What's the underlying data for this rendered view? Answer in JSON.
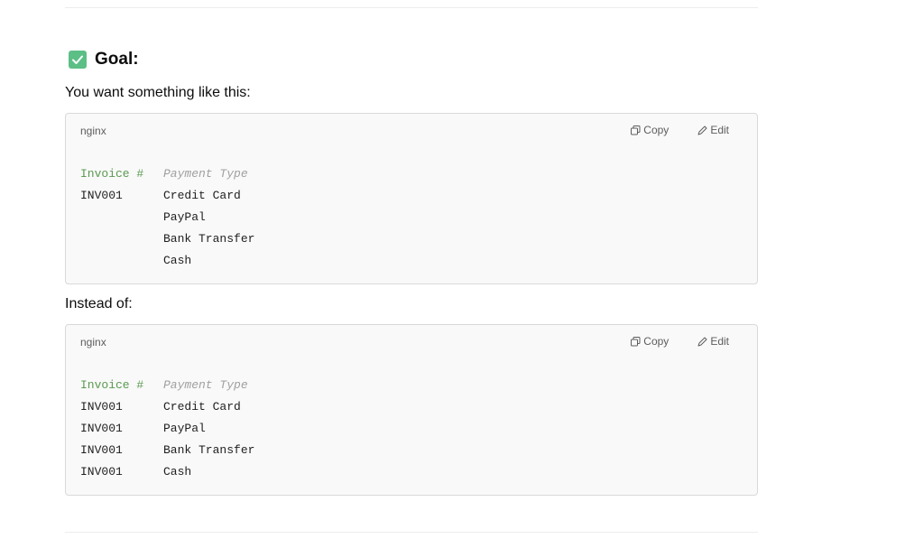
{
  "heading": {
    "icon": "check-mark-button-icon",
    "text": "Goal:"
  },
  "para1": "You want something like this:",
  "para2": "Instead of:",
  "code_blocks": [
    {
      "language": "nginx",
      "copy_label": "Copy",
      "edit_label": "Edit",
      "header": {
        "col1": "Invoice #",
        "col2": "Payment Type"
      },
      "rows": [
        {
          "col1": "INV001",
          "col2": "Credit Card"
        },
        {
          "col1": "",
          "col2": "PayPal"
        },
        {
          "col1": "",
          "col2": "Bank Transfer"
        },
        {
          "col1": "",
          "col2": "Cash"
        }
      ]
    },
    {
      "language": "nginx",
      "copy_label": "Copy",
      "edit_label": "Edit",
      "header": {
        "col1": "Invoice #",
        "col2": "Payment Type"
      },
      "rows": [
        {
          "col1": "INV001",
          "col2": "Credit Card"
        },
        {
          "col1": "INV001",
          "col2": "PayPal"
        },
        {
          "col1": "INV001",
          "col2": "Bank Transfer"
        },
        {
          "col1": "INV001",
          "col2": "Cash"
        }
      ]
    }
  ],
  "colors": {
    "check_icon": "#5cbf85",
    "header_invoice": "#5a9a50",
    "header_payment": "#a0a0a0",
    "code_bg": "#f9f9f9"
  }
}
